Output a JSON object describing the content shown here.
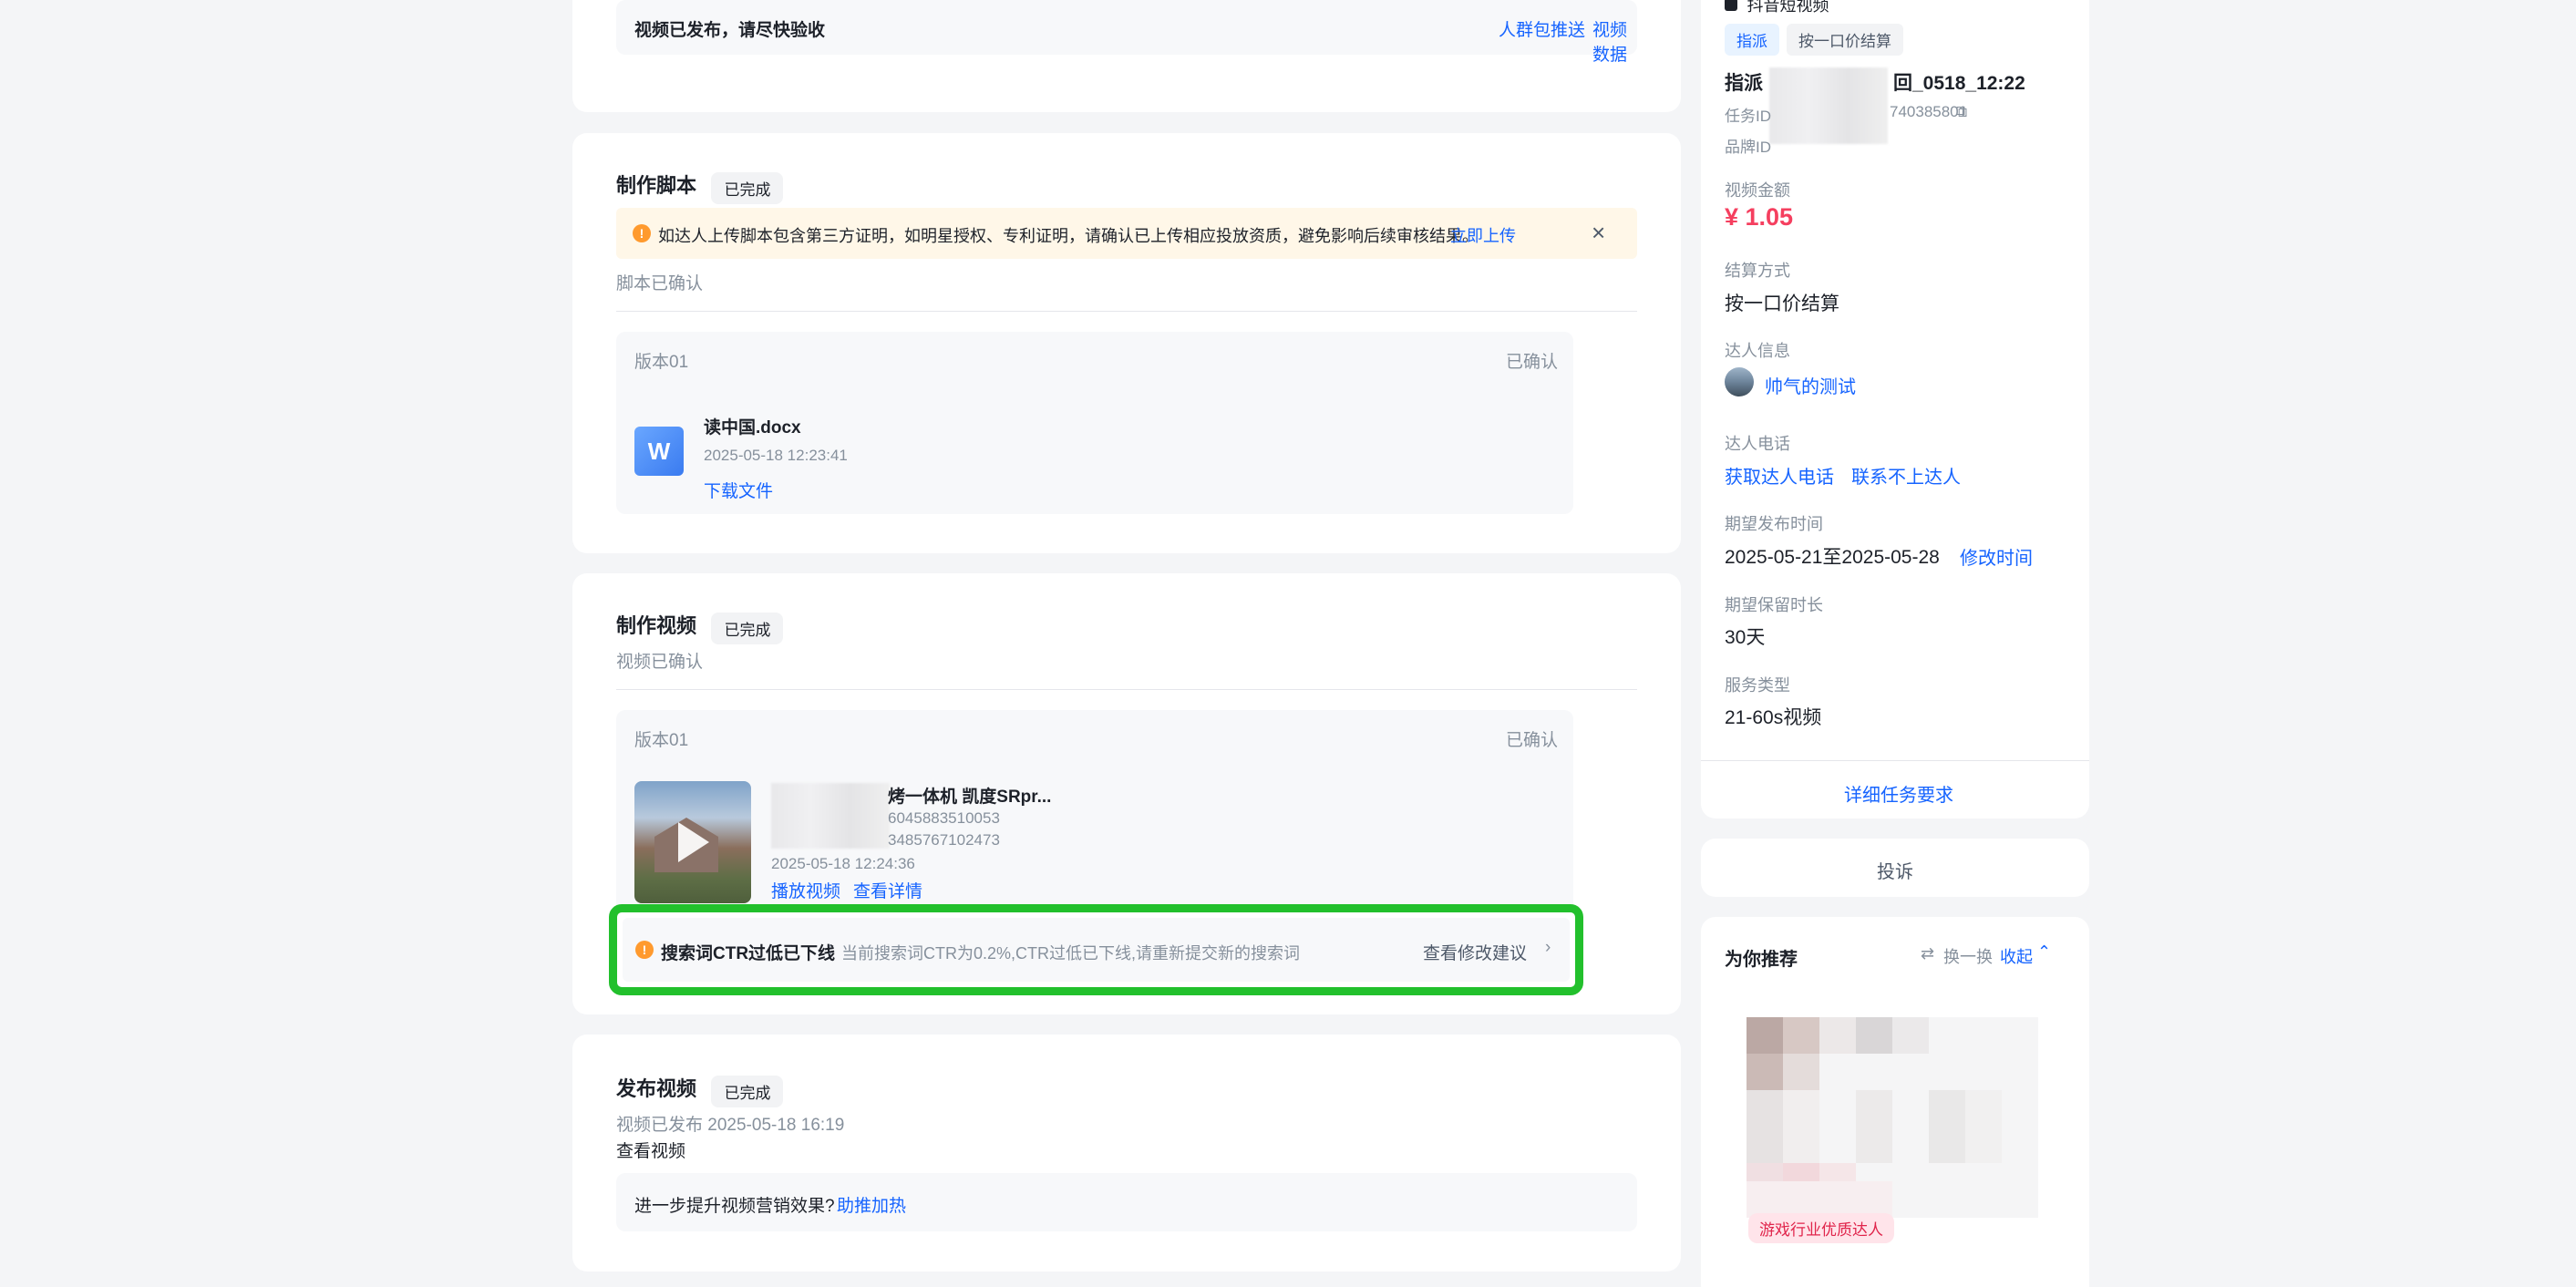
{
  "publish_top": {
    "text": "视频已发布，请尽快验收",
    "link_crowd": "人群包推送",
    "link_data": "视频数据"
  },
  "script_section": {
    "title": "制作脚本",
    "badge": "已完成",
    "alert_text": "如达人上传脚本包含第三方证明，如明星授权、专利证明，请确认已上传相应投放资质，避免影响后续审核结果。",
    "alert_link": "立即上传",
    "status": "脚本已确认",
    "version_label": "版本01",
    "version_status": "已确认",
    "file_name": "读中国.docx",
    "file_time": "2025-05-18 12:23:41",
    "file_download": "下载文件",
    "file_icon_letter": "W"
  },
  "video_section": {
    "title": "制作视频",
    "badge": "已完成",
    "status": "视频已确认",
    "version_label": "版本01",
    "version_status": "已确认",
    "video_title": "烤一体机 凯度SRpr...",
    "video_id1": "6045883510053",
    "video_id2": "3485767102473",
    "video_time": "2025-05-18 12:24:36",
    "play_link": "播放视频",
    "detail_link": "查看详情",
    "warning_title": "搜索词CTR过低已下线",
    "warning_text": "当前搜索词CTR为0.2%,CTR过低已下线,请重新提交新的搜索词",
    "warning_link": "查看修改建议"
  },
  "publish_section": {
    "title": "发布视频",
    "badge": "已完成",
    "published_time": "视频已发布 2025-05-18 16:19",
    "view_video": "查看视频",
    "promo_question": "进一步提升视频营销效果?",
    "promo_link": "助推加热"
  },
  "right_panel": {
    "platform": "抖音短视频",
    "tag_assign": "指派",
    "tag_settle": "按一口价结算",
    "task_name_prefix": "指派",
    "task_name_suffix": "回_0518_12:22",
    "task_id_label": "任务ID",
    "task_id_suffix": "740385801",
    "brand_id_label": "品牌ID",
    "amount_label": "视频金额",
    "amount_value": "¥ 1.05",
    "settle_label": "结算方式",
    "settle_value": "按一口价结算",
    "creator_label": "达人信息",
    "creator_name": "帅气的测试",
    "phone_label": "达人电话",
    "phone_get": "获取达人电话",
    "phone_unreachable": "联系不上达人",
    "expect_publish_label": "期望发布时间",
    "expect_publish_value": "2025-05-21至2025-05-28",
    "modify_time": "修改时间",
    "retain_label": "期望保留时长",
    "retain_value": "30天",
    "service_label": "服务类型",
    "service_value": "21-60s视频",
    "detail_req": "详细任务要求",
    "complaint": "投诉",
    "recommend_title": "为你推荐",
    "swap": "换一换",
    "collapse": "收起",
    "creator_tag": "游戏行业优质达人"
  },
  "colors": {
    "accent": "#1664ff",
    "price": "#f53f5f",
    "warning": "#ff9a2e",
    "highlight": "#22c02c"
  },
  "icons": {
    "warning": "warning-circle-icon",
    "close": "close-icon",
    "play": "play-icon",
    "word": "word-doc-icon",
    "swap": "swap-icon",
    "chevron_up": "chevron-up-icon",
    "chevron_right": "chevron-right-icon",
    "copy": "copy-icon"
  }
}
